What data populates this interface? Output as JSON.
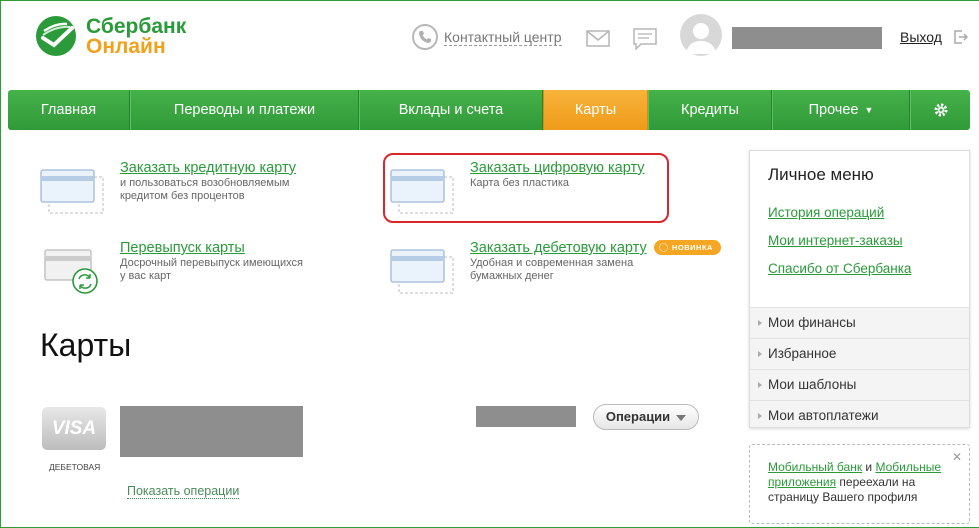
{
  "header": {
    "logo_line1": "Сбербанк",
    "logo_line2": "Онлайн",
    "contact_center": "Контактный центр",
    "logout": "Выход"
  },
  "nav": {
    "items": [
      {
        "label": "Главная"
      },
      {
        "label": "Переводы и платежи"
      },
      {
        "label": "Вклады и счета"
      },
      {
        "label": "Карты",
        "active": true
      },
      {
        "label": "Кредиты"
      },
      {
        "label": "Прочее",
        "caret": "▼"
      }
    ]
  },
  "actions": {
    "credit": {
      "title": "Заказать кредитную карту",
      "desc1": "и пользоваться возобновляемым",
      "desc2": "кредитом без процентов"
    },
    "digital": {
      "title": "Заказать цифровую карту",
      "desc1": "Карта без пластика"
    },
    "reissue": {
      "title": "Перевыпуск карты",
      "desc1": "Досрочный перевыпуск имеющихся",
      "desc2": "у вас карт"
    },
    "debit": {
      "title": "Заказать дебетовую карту",
      "badge": "НОВИНКА",
      "desc1": "Удобная и современная замена",
      "desc2": "бумажных денег"
    }
  },
  "page_title": "Карты",
  "card": {
    "brand": "VISA",
    "type": "ДЕБЕТОВАЯ",
    "operations_button": "Операции",
    "show_operations": "Показать операции"
  },
  "sidebar": {
    "title": "Личное меню",
    "links": [
      "История операций",
      "Мои интернет-заказы",
      "Спасибо от Сбербанка"
    ],
    "items": [
      "Мои финансы",
      "Избранное",
      "Мои шаблоны",
      "Мои автоплатежи"
    ]
  },
  "note": {
    "link1": "Мобильный банк",
    "and": " и ",
    "link2": "Мобильные приложения",
    "rest": " переехали на страницу Вашего профиля",
    "close": "✕"
  },
  "colors": {
    "brand_green": "#2a9a3a",
    "brand_orange": "#f0a11e",
    "highlight_red": "#d8262d"
  }
}
